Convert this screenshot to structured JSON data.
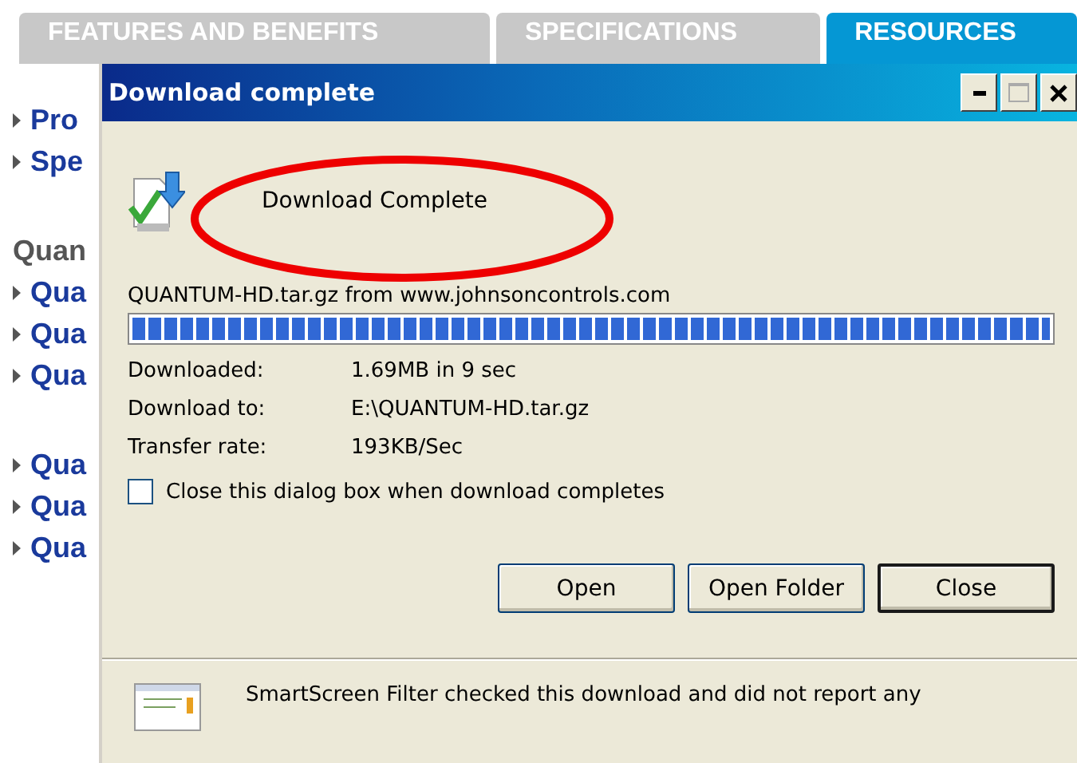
{
  "page_tabs": [
    {
      "label": "FEATURES AND BENEFITS",
      "selected": false
    },
    {
      "label": "SPECIFICATIONS",
      "selected": false
    },
    {
      "label": "RESOURCES",
      "selected": true
    }
  ],
  "sidebar": {
    "items": [
      {
        "kind": "link",
        "label": "Pro"
      },
      {
        "kind": "link",
        "label": "Spe"
      },
      {
        "kind": "gap"
      },
      {
        "kind": "heading",
        "label": "Quan"
      },
      {
        "kind": "link",
        "label": "Qua"
      },
      {
        "kind": "link",
        "label": "Qua"
      },
      {
        "kind": "link",
        "label": "Qua"
      },
      {
        "kind": "gap"
      },
      {
        "kind": "link",
        "label": "Qua"
      },
      {
        "kind": "link",
        "label": "Qua"
      },
      {
        "kind": "link",
        "label": "Qua"
      }
    ]
  },
  "dialog": {
    "title": "Download complete",
    "status": "Download Complete",
    "highlighted": true,
    "source": "QUANTUM-HD.tar.gz from www.johnsoncontrols.com",
    "progress": {
      "level": 1
    },
    "details": [
      {
        "label": "Downloaded:",
        "value": "1.69MB in 9 sec"
      },
      {
        "label": "Download to:",
        "value": "E:\\QUANTUM-HD.tar.gz"
      },
      {
        "label": "Transfer rate:",
        "value": "193KB/Sec"
      }
    ],
    "close_when_done": {
      "label": "Close this dialog box when download completes",
      "checked": false
    },
    "buttons": [
      {
        "label": "Open",
        "default": false
      },
      {
        "label": "Open Folder",
        "default": false
      },
      {
        "label": "Close",
        "default": true
      }
    ],
    "smartscreen": "SmartScreen Filter checked this download and did not report any"
  }
}
